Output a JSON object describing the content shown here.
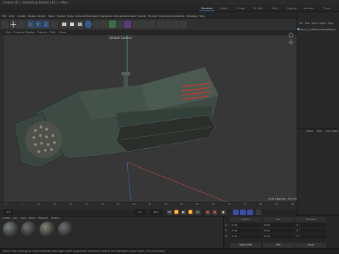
{
  "title_bar": {
    "text": "Cinema 4D — [Demining Robotic.c4d] — Main"
  },
  "layout_tabs": [
    "Standard",
    "Model",
    "Sculpt",
    "UV Edit",
    "Paint",
    "Rigging",
    "Animate",
    "Track"
  ],
  "menu": [
    "File",
    "Edit",
    "Create",
    "Modes",
    "Select",
    "Tools",
    "Spline",
    "Mesh",
    "Volume",
    "MoGraph",
    "Character",
    "Animate",
    "Simulate",
    "Tracker",
    "Render",
    "Extensions",
    "Redshift",
    "Window",
    "Help"
  ],
  "viewport": {
    "menu": [
      "View",
      "Cameras",
      "Display",
      "Options",
      "Filter",
      "Panel"
    ],
    "camera_label": "Default Camera",
    "grid_spacing": "Grid Spacing : 50 cm"
  },
  "object_manager": {
    "menu": [
      "File",
      "Edit",
      "View",
      "Object",
      "Tags"
    ],
    "object_name": "Demi_G_MultifunctionalRobot"
  },
  "attribute_manager": {
    "menu": [
      "Mode",
      "Edit",
      "User Data"
    ]
  },
  "timeline": {
    "ticks": [
      "0",
      "5",
      "10",
      "15",
      "20",
      "25",
      "30",
      "35",
      "40",
      "45",
      "50",
      "55",
      "60",
      "65",
      "70",
      "75",
      "80",
      "85",
      "90"
    ],
    "current_frame": "0 F",
    "start_frame": "0 F",
    "end_frame": "90 F"
  },
  "material_manager": {
    "menu": [
      "Create",
      "Edit",
      "View",
      "Select",
      "Material",
      "Texture"
    ],
    "materials": [
      "Mat.1",
      "Mat.2",
      "Mat.3",
      "Mat.4",
      "Mat.5"
    ]
  },
  "coordinates": {
    "headers": [
      "Position",
      "Size",
      "Rotation"
    ],
    "rows": [
      {
        "axis": "X",
        "pos": "0 cm",
        "size": "0 cm",
        "rot": "0 °"
      },
      {
        "axis": "Y",
        "pos": "0 cm",
        "size": "0 cm",
        "rot": "0 °"
      },
      {
        "axis": "Z",
        "pos": "0 cm",
        "size": "0 cm",
        "rot": "0 °"
      }
    ],
    "mode_object": "Object (Rel)",
    "mode_size": "Size",
    "apply": "Apply"
  },
  "status": "Move: Click and drag to move elements. Hold down SHIFT to quantize movement / add to the selection in point mode, CTRL to remove."
}
